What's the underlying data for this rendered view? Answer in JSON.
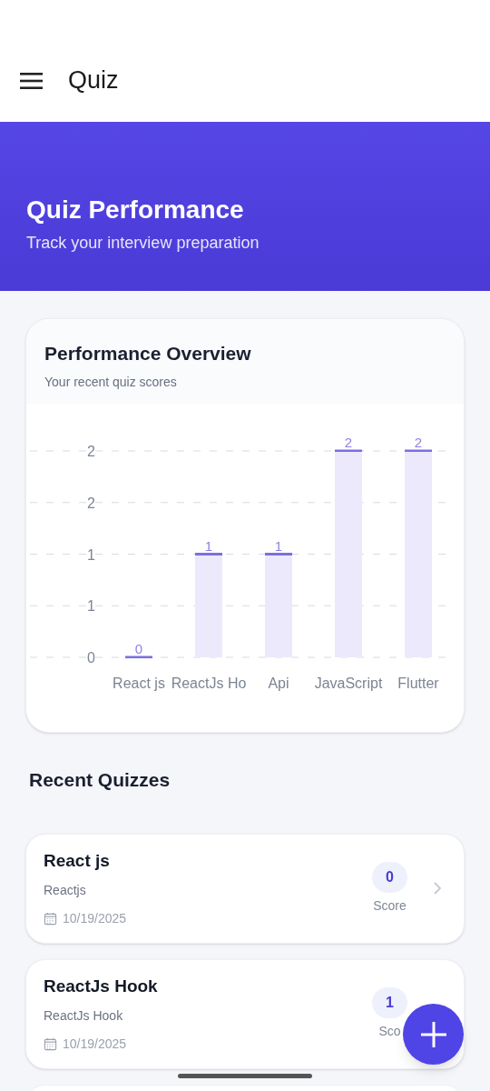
{
  "app_bar": {
    "title": "Quiz"
  },
  "hero": {
    "title": "Quiz Performance",
    "subtitle": "Track your interview preparation"
  },
  "overview": {
    "title": "Performance Overview",
    "subtitle": "Your recent quiz scores",
    "chart_data": {
      "type": "bar",
      "categories": [
        "React js",
        "ReactJs Ho",
        "Api",
        "JavaScript",
        "Flutter"
      ],
      "values": [
        0,
        1,
        1,
        2,
        2
      ],
      "ylim": [
        0,
        2
      ],
      "yticks": [
        {
          "value": 0,
          "label": "0"
        },
        {
          "value": 0.5,
          "label": "1"
        },
        {
          "value": 1,
          "label": "1"
        },
        {
          "value": 1.5,
          "label": "2"
        },
        {
          "value": 2,
          "label": "2"
        }
      ],
      "data_labels": true,
      "grid": true
    }
  },
  "recent": {
    "title": "Recent Quizzes",
    "quizzes": [
      {
        "title": "React js",
        "subtitle": "Reactjs",
        "date": "10/19/2025",
        "score": "0",
        "score_label": "Score"
      },
      {
        "title": "ReactJs Hook",
        "subtitle": "ReactJs Hook",
        "date": "10/19/2025",
        "score": "1",
        "score_label": "Sco"
      }
    ]
  }
}
